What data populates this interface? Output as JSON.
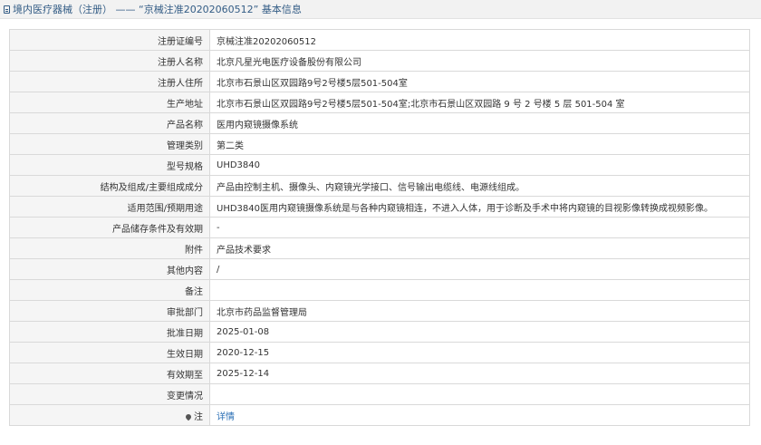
{
  "header": {
    "title": "境内医疗器械（注册） —— “京械注准20202060512” 基本信息"
  },
  "rows": [
    {
      "label": "注册证编号",
      "value": "京械注准20202060512"
    },
    {
      "label": "注册人名称",
      "value": "北京凡星光电医疗设备股份有限公司"
    },
    {
      "label": "注册人住所",
      "value": "北京市石景山区双园路9号2号楼5层501-504室"
    },
    {
      "label": "生产地址",
      "value": "北京市石景山区双园路9号2号楼5层501-504室;北京市石景山区双园路 9 号 2 号楼 5 层 501-504 室"
    },
    {
      "label": "产品名称",
      "value": "医用内窥镜摄像系统"
    },
    {
      "label": "管理类别",
      "value": "第二类"
    },
    {
      "label": "型号规格",
      "value": "UHD3840"
    },
    {
      "label": "结构及组成/主要组成成分",
      "value": "产品由控制主机、摄像头、内窥镜光学接口、信号输出电缆线、电源线组成。"
    },
    {
      "label": "适用范围/预期用途",
      "value": "UHD3840医用内窥镜摄像系统是与各种内窥镜相连，不进入人体，用于诊断及手术中将内窥镜的目视影像转换成视频影像。"
    },
    {
      "label": "产品储存条件及有效期",
      "value": "-"
    },
    {
      "label": "附件",
      "value": "产品技术要求"
    },
    {
      "label": "其他内容",
      "value": "/"
    },
    {
      "label": "备注",
      "value": ""
    },
    {
      "label": "审批部门",
      "value": "北京市药品监督管理局"
    },
    {
      "label": "批准日期",
      "value": "2025-01-08"
    },
    {
      "label": "生效日期",
      "value": "2020-12-15"
    },
    {
      "label": "有效期至",
      "value": "2025-12-14"
    },
    {
      "label": "变更情况",
      "value": ""
    },
    {
      "label": "注",
      "value": "详情"
    }
  ]
}
